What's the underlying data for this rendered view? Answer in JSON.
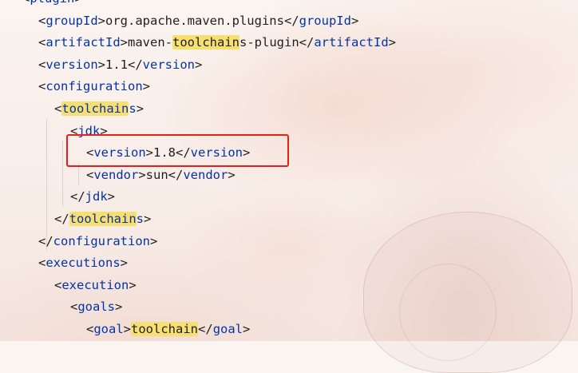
{
  "editor": {
    "language": "xml",
    "lines": [
      {
        "indent": 1,
        "segments": [
          {
            "t": "<",
            "k": "p"
          },
          {
            "t": "plugin",
            "k": "tag"
          },
          {
            "t": ">",
            "k": "p"
          }
        ]
      },
      {
        "indent": 2,
        "segments": [
          {
            "t": "<",
            "k": "p"
          },
          {
            "t": "groupId",
            "k": "tag"
          },
          {
            "t": ">org.apache.maven.plugins</",
            "k": "p"
          },
          {
            "t": "groupId",
            "k": "tag"
          },
          {
            "t": ">",
            "k": "p"
          }
        ]
      },
      {
        "indent": 2,
        "segments": [
          {
            "t": "<",
            "k": "p"
          },
          {
            "t": "artifactId",
            "k": "tag"
          },
          {
            "t": ">maven-",
            "k": "p"
          },
          {
            "t": "toolchain",
            "k": "hl"
          },
          {
            "t": "s-plugin</",
            "k": "p"
          },
          {
            "t": "artifactId",
            "k": "tag"
          },
          {
            "t": ">",
            "k": "p"
          }
        ]
      },
      {
        "indent": 2,
        "segments": [
          {
            "t": "<",
            "k": "p"
          },
          {
            "t": "version",
            "k": "tag"
          },
          {
            "t": ">1.1</",
            "k": "p"
          },
          {
            "t": "version",
            "k": "tag"
          },
          {
            "t": ">",
            "k": "p"
          }
        ]
      },
      {
        "indent": 2,
        "segments": [
          {
            "t": "<",
            "k": "p"
          },
          {
            "t": "configuration",
            "k": "tag"
          },
          {
            "t": ">",
            "k": "p"
          }
        ]
      },
      {
        "indent": 3,
        "segments": [
          {
            "t": "<",
            "k": "p"
          },
          {
            "t": "toolchain",
            "k": "hltag"
          },
          {
            "t": "s",
            "k": "tag"
          },
          {
            "t": ">",
            "k": "p"
          }
        ]
      },
      {
        "indent": 4,
        "segments": [
          {
            "t": "<",
            "k": "p"
          },
          {
            "t": "jdk",
            "k": "tag"
          },
          {
            "t": ">",
            "k": "p"
          }
        ]
      },
      {
        "indent": 5,
        "segments": [
          {
            "t": "<",
            "k": "p"
          },
          {
            "t": "version",
            "k": "tag"
          },
          {
            "t": ">1.8</",
            "k": "p"
          },
          {
            "t": "version",
            "k": "tag"
          },
          {
            "t": ">",
            "k": "p"
          }
        ]
      },
      {
        "indent": 5,
        "segments": [
          {
            "t": "<",
            "k": "p"
          },
          {
            "t": "vendor",
            "k": "tag"
          },
          {
            "t": ">sun</",
            "k": "p"
          },
          {
            "t": "vendor",
            "k": "tag"
          },
          {
            "t": ">",
            "k": "p"
          }
        ]
      },
      {
        "indent": 4,
        "segments": [
          {
            "t": "</",
            "k": "p"
          },
          {
            "t": "jdk",
            "k": "tag"
          },
          {
            "t": ">",
            "k": "p"
          }
        ]
      },
      {
        "indent": 3,
        "segments": [
          {
            "t": "</",
            "k": "p"
          },
          {
            "t": "toolchain",
            "k": "hltag"
          },
          {
            "t": "s",
            "k": "tag"
          },
          {
            "t": ">",
            "k": "p"
          }
        ]
      },
      {
        "indent": 2,
        "segments": [
          {
            "t": "</",
            "k": "p"
          },
          {
            "t": "configuration",
            "k": "tag"
          },
          {
            "t": ">",
            "k": "p"
          }
        ]
      },
      {
        "indent": 2,
        "segments": [
          {
            "t": "<",
            "k": "p"
          },
          {
            "t": "executions",
            "k": "tag"
          },
          {
            "t": ">",
            "k": "p"
          }
        ]
      },
      {
        "indent": 3,
        "segments": [
          {
            "t": "<",
            "k": "p"
          },
          {
            "t": "execution",
            "k": "tag"
          },
          {
            "t": ">",
            "k": "p"
          }
        ]
      },
      {
        "indent": 4,
        "segments": [
          {
            "t": "<",
            "k": "p"
          },
          {
            "t": "goals",
            "k": "tag"
          },
          {
            "t": ">",
            "k": "p"
          }
        ]
      },
      {
        "indent": 5,
        "segments": [
          {
            "t": "<",
            "k": "p"
          },
          {
            "t": "goal",
            "k": "tag"
          },
          {
            "t": ">",
            "k": "p"
          },
          {
            "t": "toolchain",
            "k": "hl"
          },
          {
            "t": "</",
            "k": "p"
          },
          {
            "t": "goal",
            "k": "tag"
          },
          {
            "t": ">",
            "k": "p"
          }
        ]
      }
    ],
    "annotation": {
      "type": "red-box",
      "target_line": 8
    },
    "colors": {
      "tag": "#0433a8",
      "plain": "#1f1f1f",
      "highlight": "#f8df72",
      "box": "#e51f1f"
    }
  }
}
